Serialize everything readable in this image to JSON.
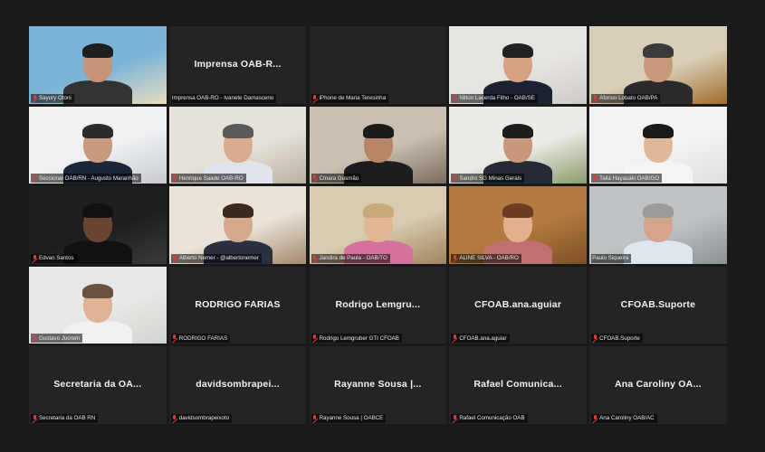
{
  "participants": [
    {
      "name": "Sayury Otoni",
      "display": "",
      "video": true,
      "muted": true,
      "bg": "#7ab4d8",
      "bg2": "#e8dcc0",
      "skin": "#c69378",
      "shirt": "#333333",
      "hair": "#1f1f1f"
    },
    {
      "name": "Imprensa OAB-RO - Ivanete Damasceno",
      "display": "Imprensa OAB-R...",
      "video": false,
      "muted": false
    },
    {
      "name": "iPhone de Maria Teresinha",
      "display": "",
      "video": false,
      "muted": true
    },
    {
      "name": "Nilton Lacerda Filho - OAB/SE",
      "display": "",
      "video": true,
      "muted": true,
      "bg": "#e7e5e1",
      "bg2": "#cfccc7",
      "skin": "#d5a183",
      "shirt": "#1b2233",
      "hair": "#222222"
    },
    {
      "name": "Afonso Lobato OAB/PA",
      "display": "",
      "video": true,
      "muted": true,
      "bg": "#d9cfb8",
      "bg2": "#a06c2c",
      "skin": "#c8997a",
      "shirt": "#2a2a2a",
      "hair": "#3b3b3b"
    },
    {
      "name": "Seccional OAB/RN - Augusto Maranhão",
      "display": "",
      "video": true,
      "muted": true,
      "bg": "#eef0f2",
      "bg2": "#c7cbd0",
      "skin": "#c99a7d",
      "shirt": "#1d2538",
      "hair": "#2a2a2a"
    },
    {
      "name": "Henrique Saade OAB-RO",
      "display": "",
      "video": true,
      "muted": true,
      "bg": "#e6e2da",
      "bg2": "#b9b0a2",
      "skin": "#d9ab8f",
      "shirt": "#dfe3ea",
      "hair": "#5a5a5a"
    },
    {
      "name": "Cínara Gusmão",
      "display": "",
      "video": true,
      "muted": true,
      "bg": "#c9c0b2",
      "bg2": "#7b6c5d",
      "skin": "#b78465",
      "shirt": "#1d1d1d",
      "hair": "#1a1a1a"
    },
    {
      "name": "Sandro SG Minas Gerais",
      "display": "",
      "video": true,
      "muted": true,
      "bg": "#ecebe6",
      "bg2": "#8b9b6b",
      "skin": "#c9977a",
      "shirt": "#252a35",
      "hair": "#1c1c1c"
    },
    {
      "name": "Taila Hayasaki OAB/GO",
      "display": "",
      "video": true,
      "muted": true,
      "bg": "#f2f2f2",
      "bg2": "#e0e0e0",
      "skin": "#e0b898",
      "shirt": "#f5f5f5",
      "hair": "#1a1a1a"
    },
    {
      "name": "Edvan Santos",
      "display": "",
      "video": true,
      "muted": true,
      "bg": "#1e1e1e",
      "bg2": "#3a3a3a",
      "skin": "#6a4632",
      "shirt": "#111111",
      "hair": "#111111"
    },
    {
      "name": "Alberto Nemer - @albertonemer",
      "display": "",
      "video": true,
      "muted": true,
      "bg": "#e9e3d9",
      "bg2": "#a58a6e",
      "skin": "#d4a98c",
      "shirt": "#2a3040",
      "hair": "#3a2a1e"
    },
    {
      "name": "Jandira de Paula - OAB/TO",
      "display": "",
      "video": true,
      "muted": true,
      "bg": "#d8cbb0",
      "bg2": "#a1835c",
      "skin": "#e2b594",
      "shirt": "#d6719b",
      "hair": "#c8a978"
    },
    {
      "name": "ALINE SILVA - OAB/RO",
      "display": "",
      "video": true,
      "muted": true,
      "bg": "#b27a3e",
      "bg2": "#7f4f25",
      "skin": "#e2b08f",
      "shirt": "#c0706e",
      "hair": "#6b3b24"
    },
    {
      "name": "Paulo Siqueira",
      "display": "",
      "video": true,
      "muted": false,
      "active": true,
      "bg": "#bfc3c6",
      "bg2": "#8c9194",
      "skin": "#d4a58a",
      "shirt": "#dfe6ee",
      "hair": "#9b9b9b"
    },
    {
      "name": "Gustavo Jucrem",
      "display": "",
      "video": true,
      "muted": true,
      "bg": "#e8e8e6",
      "bg2": "#d2d2cf",
      "skin": "#e0b396",
      "shirt": "#f1f1f1",
      "hair": "#6a5240"
    },
    {
      "name": "RODRIGO FARIAS",
      "display": "RODRIGO FARIAS",
      "video": false,
      "muted": true
    },
    {
      "name": "Rodrigo Lemgruber GTI CFOAB",
      "display": "Rodrigo Lemgru...",
      "video": false,
      "muted": true
    },
    {
      "name": "CFOAB.ana.aguiar",
      "display": "CFOAB.ana.aguiar",
      "video": false,
      "muted": true
    },
    {
      "name": "CFOAB.Suporte",
      "display": "CFOAB.Suporte",
      "video": false,
      "muted": true
    },
    {
      "name": "Secretaria da OAB RN",
      "display": "Secretaria da OA...",
      "video": false,
      "muted": true
    },
    {
      "name": "davidsombrapeixoto",
      "display": "davidsombrapei...",
      "video": false,
      "muted": true
    },
    {
      "name": "Rayanne Sousa | OABCE",
      "display": "Rayanne Sousa |...",
      "video": false,
      "muted": true
    },
    {
      "name": "Rafael Comunicação OAB",
      "display": "Rafael Comunica...",
      "video": false,
      "muted": true
    },
    {
      "name": "Ana Caroliny OAB/AC",
      "display": "Ana Caroliny OA...",
      "video": false,
      "muted": true
    }
  ]
}
